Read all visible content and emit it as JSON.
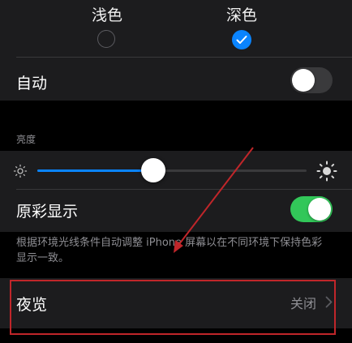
{
  "appearance": {
    "light_label": "浅色",
    "dark_label": "深色",
    "selected": "dark",
    "auto_label": "自动",
    "auto_enabled": false
  },
  "brightness": {
    "header": "亮度",
    "level": 0.43
  },
  "true_tone": {
    "label": "原彩显示",
    "enabled": true,
    "description": "根据环境光线条件自动调整 iPhone 屏幕以在不同环境下保持色彩显示一致。"
  },
  "night_shift": {
    "label": "夜览",
    "value": "关闭"
  },
  "colors": {
    "accent": "#0a84ff",
    "toggle_on": "#32c759",
    "annotation": "#c0262a"
  },
  "icons": {
    "sun_small": "sun-small-icon",
    "sun_large": "sun-large-icon",
    "chevron": "chevron-right-icon",
    "check": "checkmark-icon"
  }
}
